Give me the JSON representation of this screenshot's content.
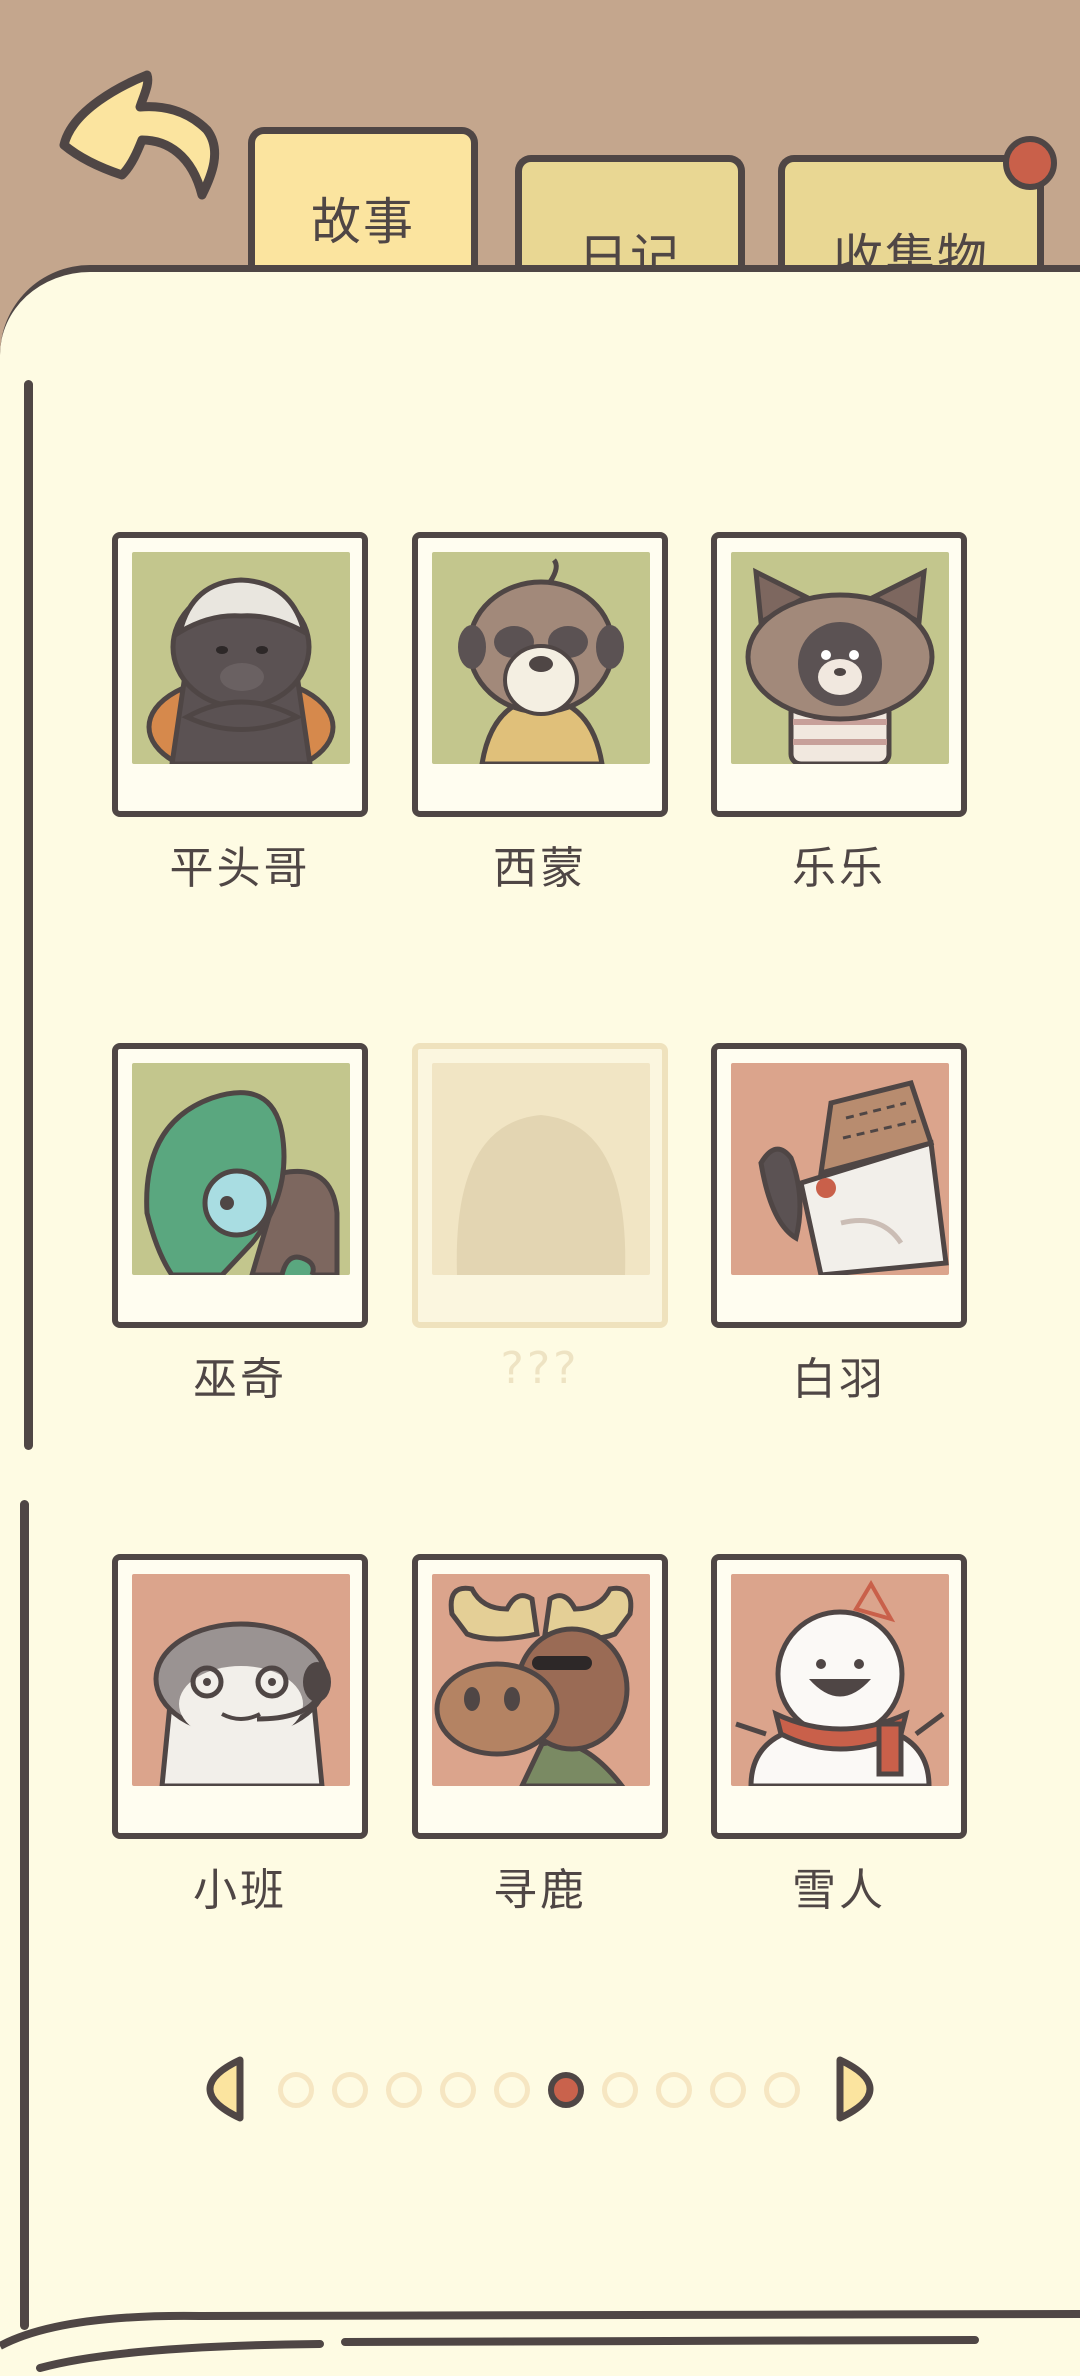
{
  "tabs": [
    {
      "label": "故事",
      "active": true
    },
    {
      "label": "日记",
      "active": false
    },
    {
      "label": "收集物",
      "active": false,
      "has_notification": true
    }
  ],
  "characters": [
    {
      "name": "平头哥",
      "icon": "honey-badger-icon",
      "bg": "#c3c68d",
      "locked": false
    },
    {
      "name": "西蒙",
      "icon": "meerkat-icon",
      "bg": "#c3c68d",
      "locked": false
    },
    {
      "name": "乐乐",
      "icon": "raccoon-dog-icon",
      "bg": "#c3c68d",
      "locked": false
    },
    {
      "name": "巫奇",
      "icon": "chameleon-icon",
      "bg": "#c3c68d",
      "locked": false
    },
    {
      "name": "???",
      "icon": "silhouette-icon",
      "bg": "#f1e5c4",
      "locked": true
    },
    {
      "name": "白羽",
      "icon": "bird-with-box-icon",
      "bg": "#dba48c",
      "locked": false
    },
    {
      "name": "小班",
      "icon": "otter-with-headset-icon",
      "bg": "#dba48c",
      "locked": false
    },
    {
      "name": "寻鹿",
      "icon": "moose-icon",
      "bg": "#dba48c",
      "locked": false
    },
    {
      "name": "雪人",
      "icon": "snowman-icon",
      "bg": "#dba48c",
      "locked": false
    }
  ],
  "pagination": {
    "total_pages": 10,
    "current_page": 6
  },
  "colors": {
    "background": "#c4a68d",
    "paper": "#fefbe3",
    "outline": "#4f4645",
    "active_tab": "#fbe49f",
    "inactive_tab": "#e9d793",
    "notification": "#c9604a",
    "pager_active": "#c9624c",
    "pager_inactive": "#f6e6c2"
  }
}
